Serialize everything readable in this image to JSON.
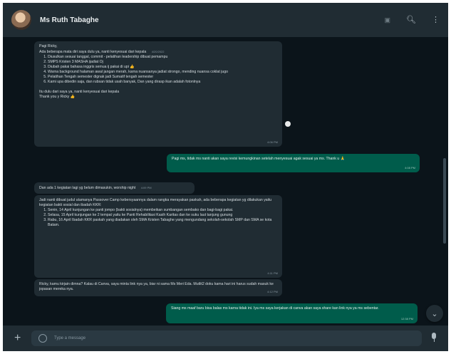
{
  "header": {
    "contact_name": "Ms Ruth Tabaghe"
  },
  "messages": [
    {
      "id": "m1",
      "direction": "in",
      "greeting": "Pagi Ricky,",
      "intro": "Ada beberapa mata diri saya dulu ya, nanti kenyesuai dari kepala",
      "intro_time": "4/20/2022",
      "items": [
        "Diusulkan sesuai tanggal, commit - pelatihan leadership dibuat pemampu",
        "SMPS Kristen 3 MASHA ijadiat Oj",
        "Diubah pakai bahasa inggris semua ij pakai di upi",
        "Warna background halaman awal jangan merah, karna nuansanya jadiat strongo, mending nuansa coklat jugo",
        "Pelatihan Tengah semester dignak jadi Sumatif tengah semester",
        "Kami upa dibedin saja, dan rubsan tidak usah banyak, Dan yang dirasp ikan adalah fotonlnya"
      ],
      "closing": "Itu dulu dari saya ya, nanti kenyesuai dari kepala",
      "signoff": "Thank you y Ricky",
      "time": "4:06 PM"
    },
    {
      "id": "m2",
      "direction": "out",
      "text": "Pagi ms, tidak ms nanti akan saya revisi kemungkinan setelah menyesuai agak sesuai ya ms. Thank u",
      "time": "4:08 PM"
    },
    {
      "id": "m3",
      "direction": "in",
      "text": "Dan ada 1 kegiatan lagi yg belum dimasukin, worship night",
      "time": "4:09 PM"
    },
    {
      "id": "m4",
      "direction": "in",
      "intro": "Jadi nanti dibuat judul utamanya Passover Camp kebersyaannya dalam rangka merayakan paskah, ada beberapa kegiatan yg dilakukan yaitu kegiatan bakti sosial dan ibadah KKR:",
      "items": [
        "Senin, 14 April kunjungan ke panti jompo (bakti sosialnya) membeikan sumbangan sembako dan bagi-bagi pakai.",
        "Selasa, 15 April kunjungan ke 2 tempat yaitu ke Panti Rehabilitasi Kasih Karitas dan ke suku laut tanjung gunung",
        "Rabu, 16 April Ibadah KKR paskah yang diadakan oleh SMA Kristen Tabaghe yang mengundang sekolah-sekolah SMP dan SMA se kota Batam."
      ],
      "time": "4:11 PM"
    },
    {
      "id": "m5",
      "direction": "in",
      "text": "Ricky, kamu kirjain dimna? Kalau di Canva, saya minta link nya ya, biar ni sama Ms Meri Eda. Mutlit2 doku kama hari ini harus sudah masuk ke jopasan mereka nya.",
      "time": "4:12 PM"
    },
    {
      "id": "m6",
      "direction": "out",
      "text": "Siang ms maaf baru bisa balas ms karna tidak ini. Iya ms saya kerjakan di canva akan saya share kan link nya ya ms sebentar.",
      "time": "12:38 PM"
    }
  ],
  "footer": {
    "placeholder": "Type a message"
  }
}
